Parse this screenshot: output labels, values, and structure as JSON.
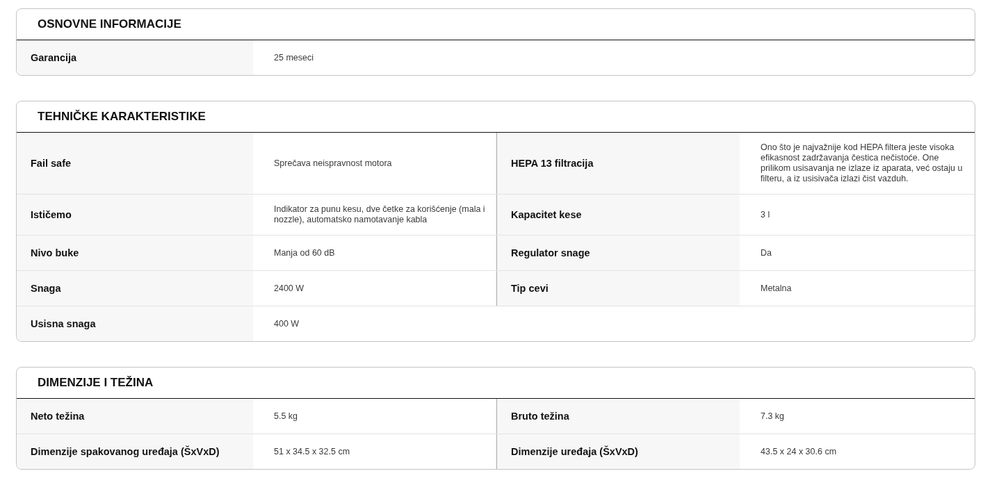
{
  "sections": [
    {
      "title": "OSNOVNE INFORMACIJE",
      "rows": [
        [
          {
            "label": "Garancija",
            "value": "25 meseci"
          }
        ]
      ]
    },
    {
      "title": "TEHNIČKE KARAKTERISTIKE",
      "rows": [
        [
          {
            "label": "Fail safe",
            "value": "Sprečava neispravnost motora"
          },
          {
            "label": "HEPA 13 filtracija",
            "value": "Ono što je najvažnije kod HEPA filtera jeste visoka efikasnost zadržavanja čestica nečistoće. One prilikom usisavanja ne izlaze iz aparata, već ostaju u filteru, a iz usisivača izlazi čist vazduh."
          }
        ],
        [
          {
            "label": "Ističemo",
            "value": "Indikator za punu kesu, dve četke za korišćenje (mala i nozzle), automatsko namotavanje kabla"
          },
          {
            "label": "Kapacitet kese",
            "value": "3 l"
          }
        ],
        [
          {
            "label": "Nivo buke",
            "value": "Manja od 60 dB"
          },
          {
            "label": "Regulator snage",
            "value": "Da"
          }
        ],
        [
          {
            "label": "Snaga",
            "value": "2400 W"
          },
          {
            "label": "Tip cevi",
            "value": "Metalna"
          }
        ],
        [
          {
            "label": "Usisna snaga",
            "value": "400 W"
          }
        ]
      ]
    },
    {
      "title": "DIMENZIJE I TEŽINA",
      "rows": [
        [
          {
            "label": "Neto težina",
            "value": "5.5 kg"
          },
          {
            "label": "Bruto težina",
            "value": "7.3 kg"
          }
        ],
        [
          {
            "label": "Dimenzije spakovanog uređaja (ŠxVxD)",
            "value": "51 x 34.5 x 32.5 cm"
          },
          {
            "label": "Dimenzije uređaja (ŠxVxD)",
            "value": "43.5 x 24 x 30.6 cm"
          }
        ]
      ]
    }
  ]
}
